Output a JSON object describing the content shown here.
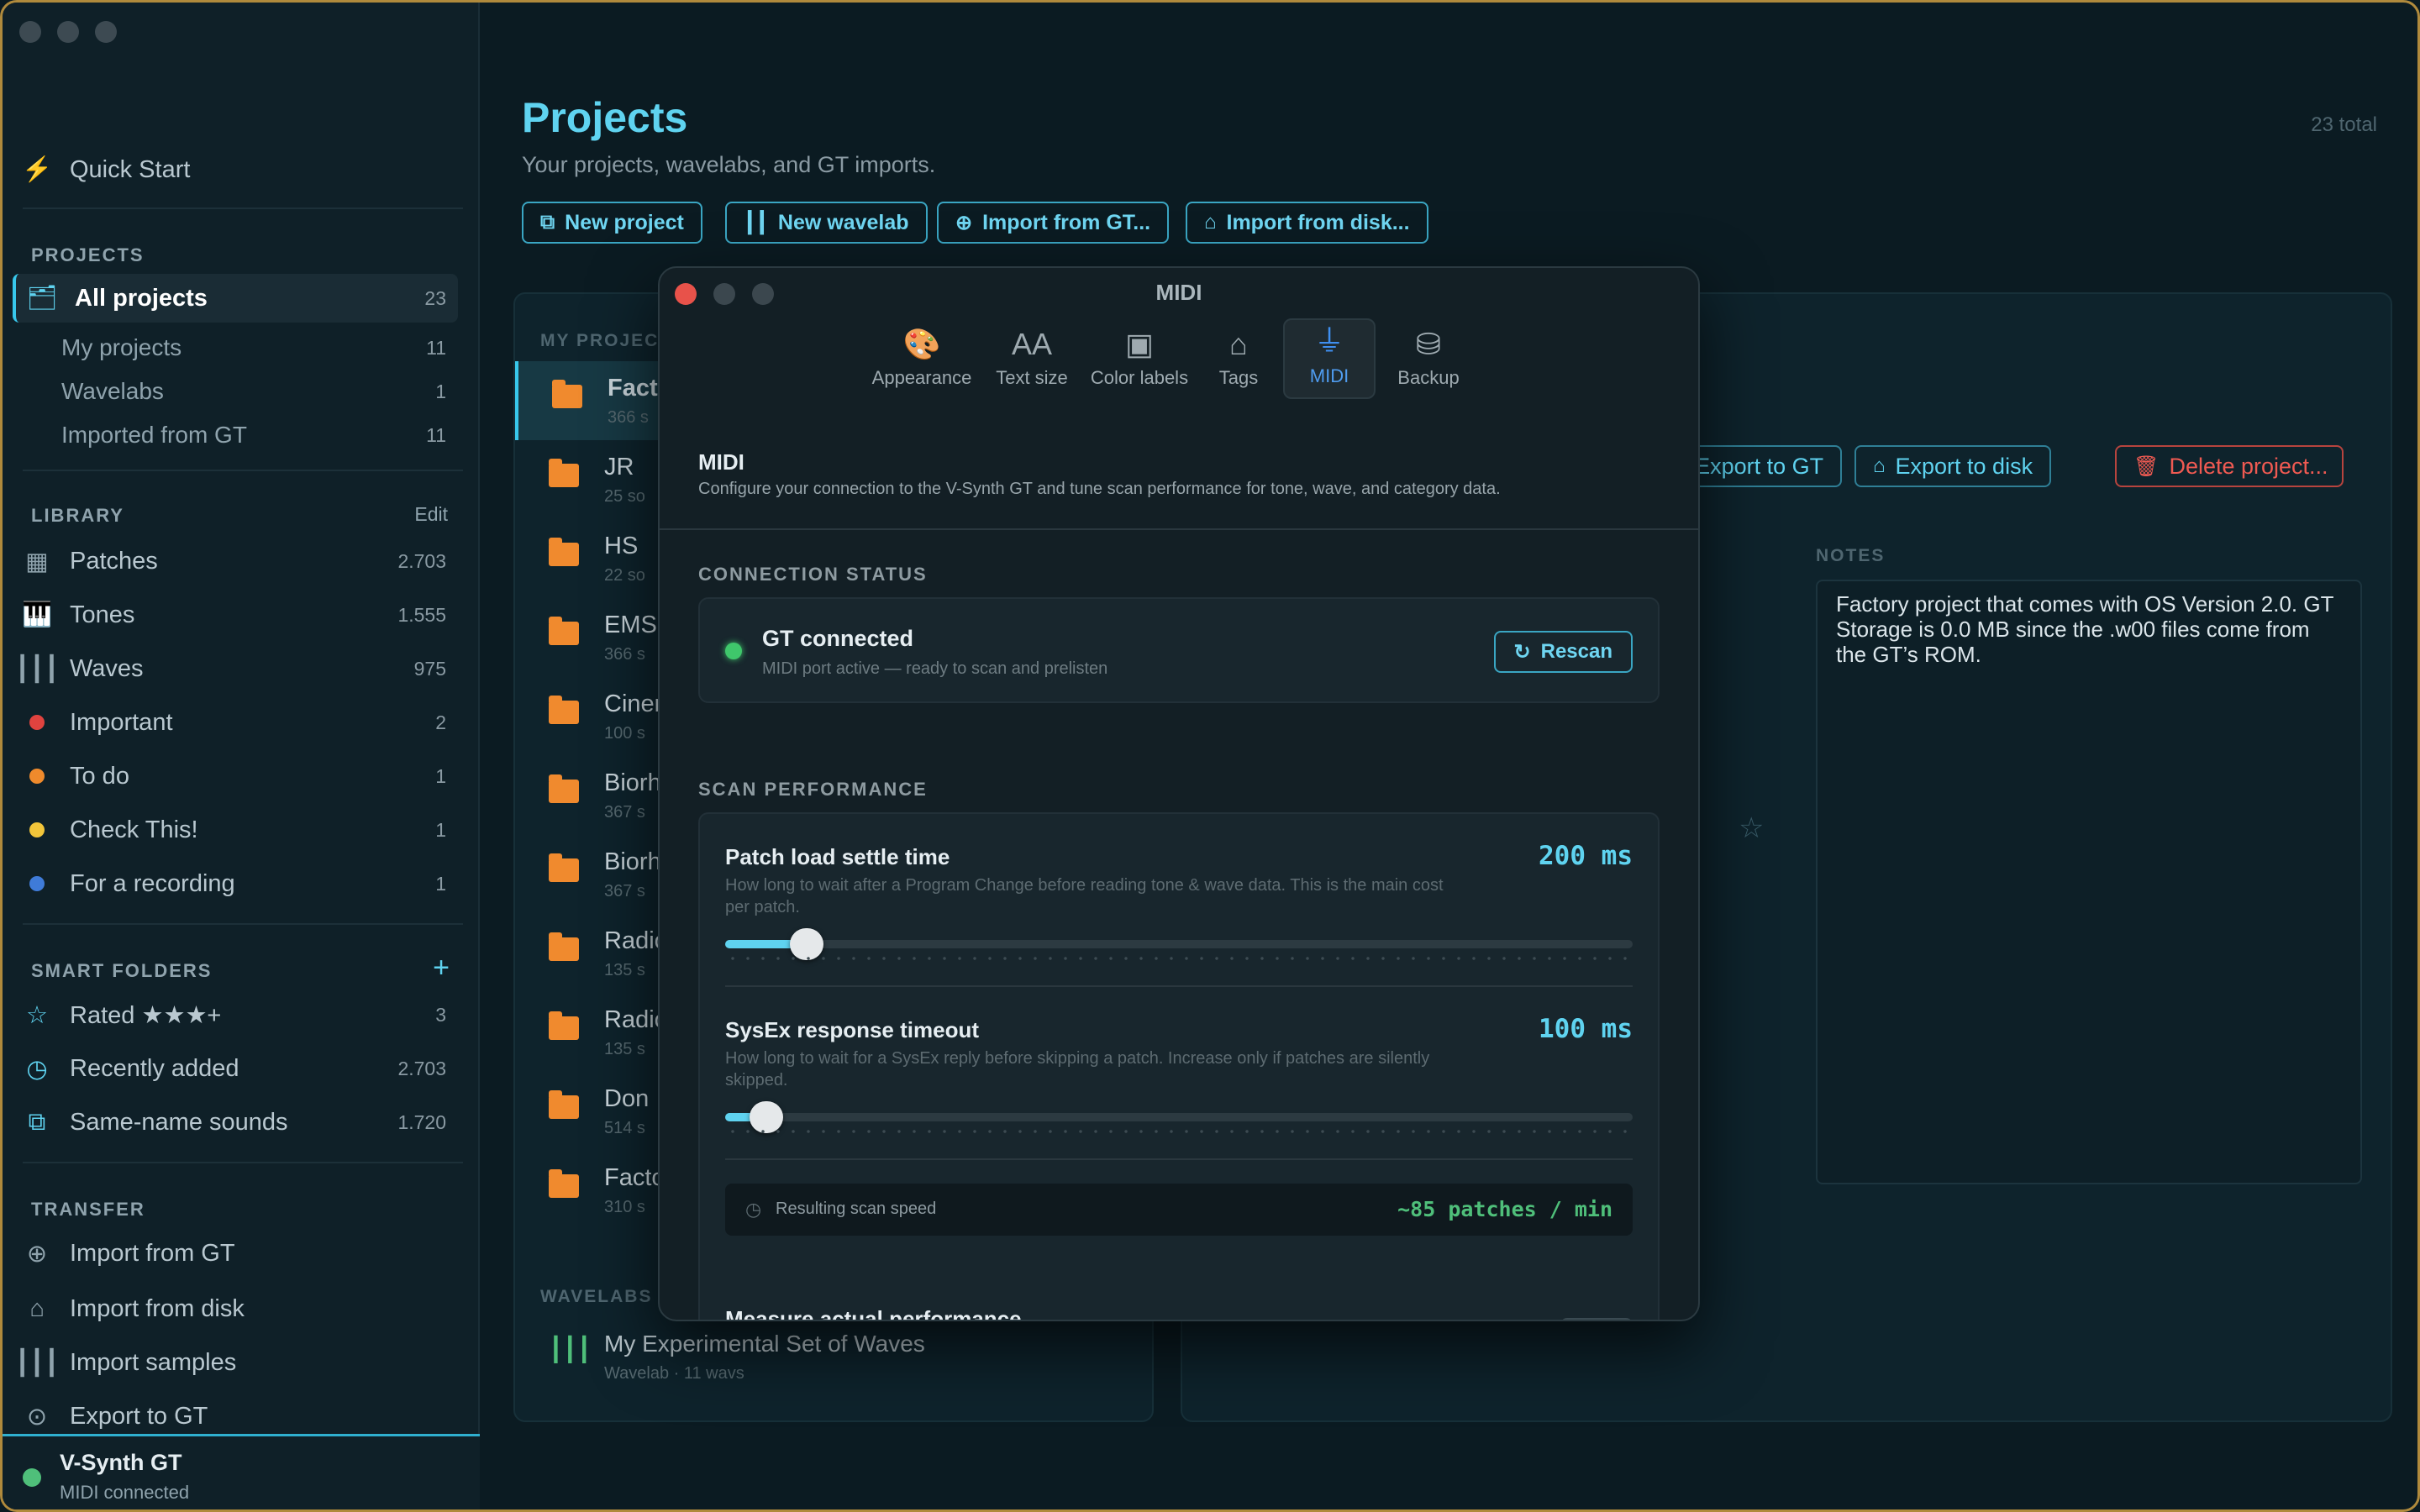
{
  "sidebar": {
    "quick_start": "Quick Start",
    "projects_header": "PROJECTS",
    "all_projects": {
      "label": "All projects",
      "count": "23"
    },
    "project_items": [
      {
        "label": "My projects",
        "count": "11"
      },
      {
        "label": "Wavelabs",
        "count": "1"
      },
      {
        "label": "Imported from GT",
        "count": "11"
      }
    ],
    "library_header": "LIBRARY",
    "library_edit": "Edit",
    "library_items": [
      {
        "label": "Patches",
        "count": "2.703"
      },
      {
        "label": "Tones",
        "count": "1.555"
      },
      {
        "label": "Waves",
        "count": "975"
      },
      {
        "label": "Important",
        "count": "2",
        "color": "#e0433f"
      },
      {
        "label": "To do",
        "count": "1",
        "color": "#ef8a2c"
      },
      {
        "label": "Check This!",
        "count": "1",
        "color": "#f2c53a"
      },
      {
        "label": "For a recording",
        "count": "1",
        "color": "#3f7bd8"
      }
    ],
    "smart_header": "SMART FOLDERS",
    "smart_add": "+",
    "smart_items": [
      {
        "label": "Rated ★★★+",
        "count": "3"
      },
      {
        "label": "Recently added",
        "count": "2.703"
      },
      {
        "label": "Same-name sounds",
        "count": "1.720"
      }
    ],
    "transfer_header": "TRANSFER",
    "transfer_items": [
      {
        "label": "Import from GT"
      },
      {
        "label": "Import from disk"
      },
      {
        "label": "Import samples"
      },
      {
        "label": "Export to GT"
      }
    ],
    "device": {
      "name": "V-Synth GT",
      "status": "MIDI connected"
    }
  },
  "main": {
    "title": "Projects",
    "subtitle": "Your projects, wavelabs, and GT imports.",
    "total": "23 total",
    "toolbar": [
      "New project",
      "New wavelab",
      "Import from GT...",
      "Import from disk..."
    ],
    "list_header": "MY PROJEC",
    "projects": [
      {
        "name": "Facto",
        "meta": "366 s"
      },
      {
        "name": "JR",
        "meta": "25 so"
      },
      {
        "name": "HS",
        "meta": "22 so"
      },
      {
        "name": "EMS",
        "meta": "366 s"
      },
      {
        "name": "Ciner",
        "meta": "100 s"
      },
      {
        "name": "Biorh",
        "meta": "367 s"
      },
      {
        "name": "Biorh",
        "meta": "367 s"
      },
      {
        "name": "Radio",
        "meta": "135 s"
      },
      {
        "name": "Radio",
        "meta": "135 s"
      },
      {
        "name": "Don",
        "meta": "514 s"
      },
      {
        "name": "Facto",
        "meta": "310 s"
      }
    ],
    "wavelabs_header": "WAVELABS",
    "wavelab": {
      "name": "My Experimental Set of Waves",
      "meta": "Wavelab · 11 wavs"
    },
    "detail": {
      "export_gt": "Export to GT",
      "export_disk": "Export to disk",
      "delete": "Delete project...",
      "notes_label": "NOTES",
      "notes": "Factory project that comes with OS Version 2.0. GT Storage is 0.0 MB since the .w00 files come from the GT’s ROM."
    }
  },
  "dialog": {
    "title": "MIDI",
    "tabs": [
      {
        "label": "Appearance",
        "icon": "palette-icon"
      },
      {
        "label": "Text size",
        "icon": "text-size-icon"
      },
      {
        "label": "Color labels",
        "icon": "color-labels-icon"
      },
      {
        "label": "Tags",
        "icon": "tag-icon"
      },
      {
        "label": "MIDI",
        "icon": "midi-plug-icon"
      },
      {
        "label": "Backup",
        "icon": "backup-drive-icon"
      }
    ],
    "section_title": "MIDI",
    "section_desc": "Configure your connection to the V-Synth GT and tune scan performance for tone, wave, and category data.",
    "connection_header": "CONNECTION STATUS",
    "connection": {
      "title": "GT connected",
      "detail": "MIDI port active — ready to scan and prelisten",
      "rescan": "Rescan"
    },
    "scan_header": "SCAN PERFORMANCE",
    "settle": {
      "title": "Patch load settle time",
      "desc": "How long to wait after a Program Change before reading tone & wave data. This is the main cost per patch.",
      "value": "200 ms",
      "fraction": 0.09
    },
    "sysex": {
      "title": "SysEx response timeout",
      "desc": "How long to wait for a SysEx reply before skipping a patch. Increase only if patches are silently skipped.",
      "value": "100 ms",
      "fraction": 0.045
    },
    "speed": {
      "label": "Resulting scan speed",
      "value": "~85 patches / min"
    },
    "measure": "Measure actual performance"
  }
}
